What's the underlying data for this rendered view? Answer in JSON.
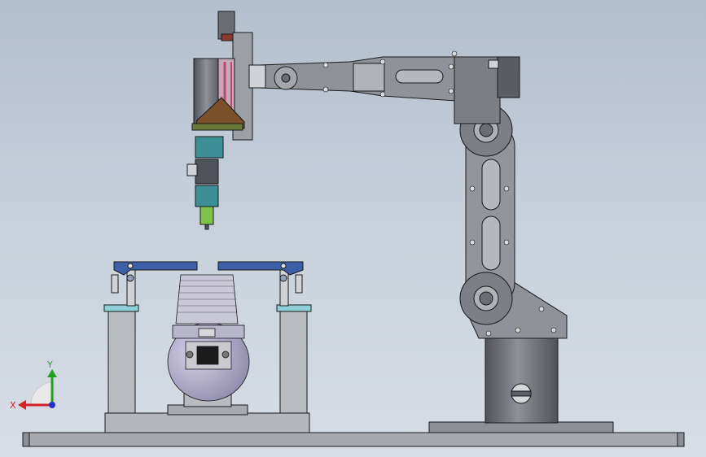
{
  "viewport": {
    "background_top": "#b4bfcd",
    "background_bottom": "#d8dee6"
  },
  "model": {
    "assembly": "robot-arm-workcell",
    "components": [
      "base-plate",
      "robot-pedestal",
      "lower-arm",
      "upper-arm",
      "end-effector",
      "fixture",
      "workpiece"
    ]
  },
  "colors": {
    "steel": "#8c8f96",
    "steel_light": "#a9adb4",
    "dark_steel": "#5d6068",
    "fixture_blue": "#3d5fa8",
    "teal": "#3d8f96",
    "green_tip": "#7fc24a",
    "edge": "#1a1a1a"
  },
  "triad": {
    "x_label": "X",
    "y_label": "Y",
    "x_color": "#d22222",
    "y_color": "#22a022",
    "z_color": "#2233cc"
  }
}
